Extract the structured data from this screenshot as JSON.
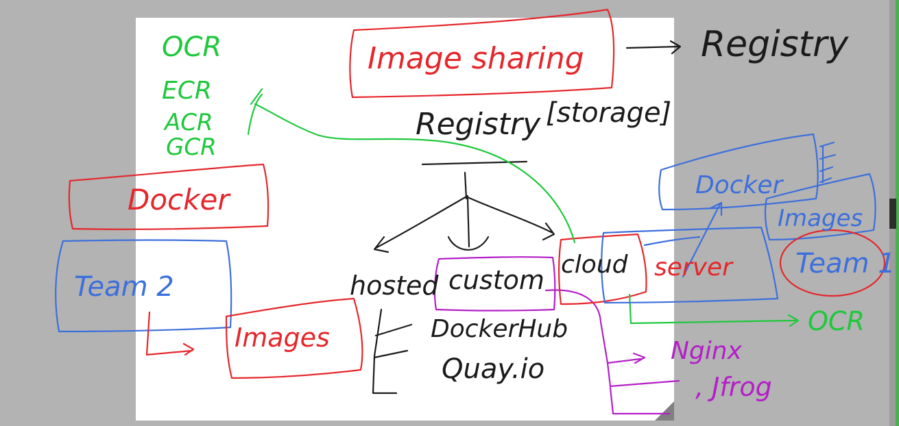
{
  "colors": {
    "black": "#1a1a1a",
    "red": "#e5262b",
    "green": "#1ec83c",
    "blue": "#3c6fdc",
    "purple": "#b41ec8",
    "board": "#ffffff",
    "background": "#b3b3b3"
  },
  "labels": {
    "image_sharing": "Image sharing",
    "registry_right": "Registry",
    "registry_center": "Registry",
    "storage": "[storage]",
    "docker": "Docker",
    "team2": "Team 2",
    "images_left": "Images",
    "hosted": "hosted",
    "custom": "custom",
    "cloud": "cloud",
    "docker_hub": "DockerHub",
    "quay": "Quay.io",
    "server": "server",
    "docker_right": "Docker",
    "images_right": "Images",
    "team1": "Team 1",
    "ocr_right": "OCR",
    "nginx": "Nginx",
    "jfrog": ", Jfrog"
  },
  "cloud_providers": [
    "OCR",
    "ECR",
    "ACR",
    "GCR"
  ],
  "icons": {
    "arrow": "arrow-icon",
    "menu": "list-lines-icon"
  }
}
